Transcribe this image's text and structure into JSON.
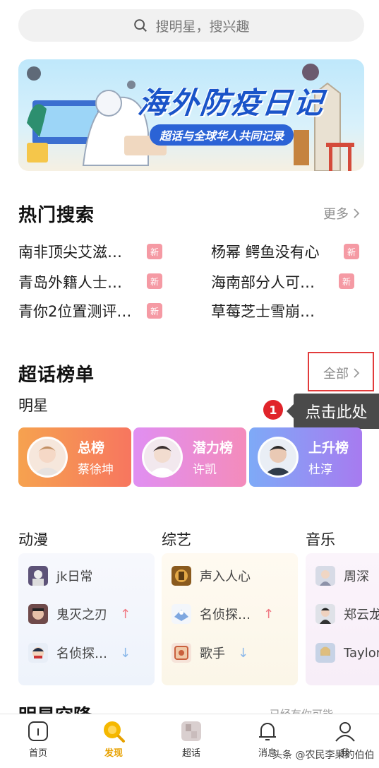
{
  "search": {
    "placeholder": "搜明星，搜兴趣"
  },
  "banner": {
    "title": "海外防疫日记",
    "subtitle": "超话与全球华人共同记录"
  },
  "hot_search": {
    "title": "热门搜索",
    "more_label": "更多",
    "new_badge": "新",
    "items": [
      {
        "text": "南非顶尖艾滋…",
        "is_new": true
      },
      {
        "text": "杨幂 鳄鱼没有心",
        "is_new": true
      },
      {
        "text": "青岛外籍人士…",
        "is_new": true
      },
      {
        "text": "海南部分人可…",
        "is_new": true
      },
      {
        "text": "青你2位置测评…",
        "is_new": true
      },
      {
        "text": "草莓芝士雪崩…",
        "is_new": false
      }
    ]
  },
  "ranking": {
    "title": "超话榜单",
    "all_label": "全部",
    "subtitle": "明星",
    "cards": [
      {
        "name": "总榜",
        "person": "蔡徐坤",
        "color_from": "#f6a24f",
        "color_to": "#f7765f"
      },
      {
        "name": "潜力榜",
        "person": "许凯",
        "color_from": "#e08ff2",
        "color_to": "#f48bbb"
      },
      {
        "name": "上升榜",
        "person": "杜淳",
        "color_from": "#7eaaf7",
        "color_to": "#a77bf0"
      }
    ]
  },
  "annotation": {
    "step": "1",
    "tip": "点击此处"
  },
  "categories": [
    {
      "title": "动漫",
      "items": [
        {
          "text": "jk日常",
          "trend": ""
        },
        {
          "text": "鬼灭之刃",
          "trend": "up"
        },
        {
          "text": "名侦探…",
          "trend": "down"
        }
      ]
    },
    {
      "title": "综艺",
      "items": [
        {
          "text": "声入人心",
          "trend": ""
        },
        {
          "text": "名侦探…",
          "trend": "up"
        },
        {
          "text": "歌手",
          "trend": "down"
        }
      ]
    },
    {
      "title": "音乐",
      "items": [
        {
          "text": "周深",
          "trend": ""
        },
        {
          "text": "郑云龙",
          "trend": ""
        },
        {
          "text": "Taylor",
          "trend": ""
        }
      ]
    }
  ],
  "next_section": {
    "title": "明星空降",
    "right": "已经有你可能…"
  },
  "trend_symbols": {
    "up": "↑",
    "down": "↓"
  },
  "tabbar": [
    {
      "label": "首页",
      "icon": "home-icon",
      "active": false
    },
    {
      "label": "发现",
      "icon": "discover-icon",
      "active": true
    },
    {
      "label": "超话",
      "icon": "supertopic-icon",
      "active": false
    },
    {
      "label": "消息",
      "icon": "bell-icon",
      "active": false
    },
    {
      "label": "我",
      "icon": "user-icon",
      "active": false
    }
  ],
  "watermark": "头条 @农民李果的伯伯",
  "colors": {
    "accent": "#e7a100",
    "badge": "#f59aa4",
    "annotation_red": "#e0242a"
  }
}
